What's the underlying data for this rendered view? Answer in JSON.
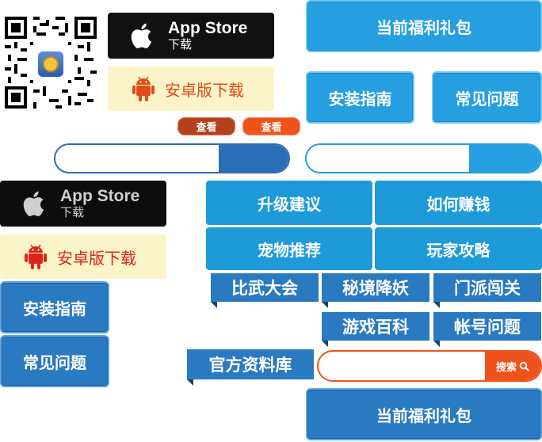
{
  "app_store": {
    "title": "App Store",
    "subtitle": "下载"
  },
  "android": {
    "label": "安卓版下载"
  },
  "buttons": {
    "welfare": "当前福利礼包",
    "install_guide": "安装指南",
    "faq": "常见问题",
    "view": "查看"
  },
  "grid": [
    "升级建议",
    "如何赚钱",
    "宠物推荐",
    "玩家攻略"
  ],
  "ribbons": [
    "比武大会",
    "秘境降妖",
    "门派闯关",
    "游戏百科",
    "帐号问题"
  ],
  "library": "官方资料库",
  "search": {
    "label": "搜索"
  },
  "colors": {
    "blue_light": "#259fe0",
    "blue_dark": "#2a7ac2",
    "orange": "#f0521b",
    "red_brown": "#b4401c",
    "android_bg": "#fbf4c9"
  }
}
